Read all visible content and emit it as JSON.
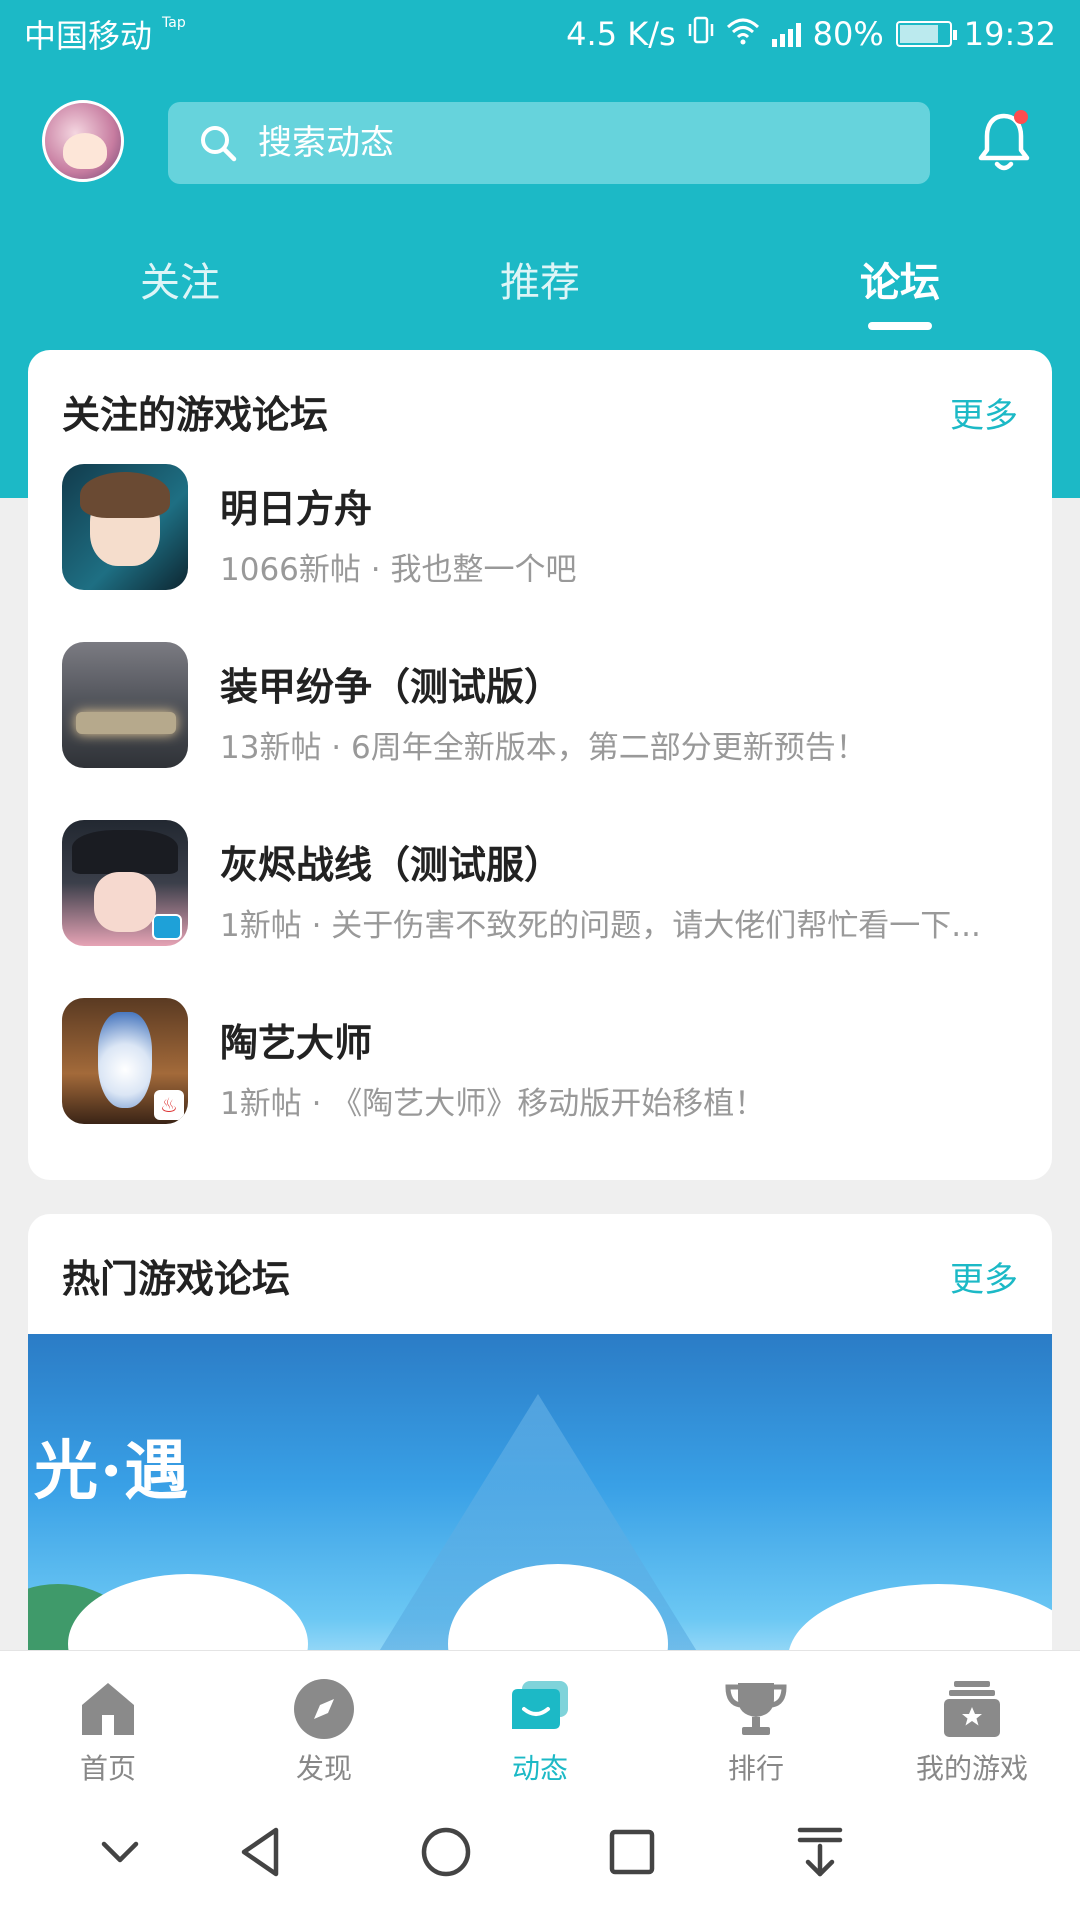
{
  "status_bar": {
    "carrier": "中国移动",
    "carrier_badge": "Tap",
    "speed": "4.5 K/s",
    "battery": "80%",
    "time": "19:32"
  },
  "header": {
    "search_placeholder": "搜索动态",
    "notification_dot_color": "#ff4d4f"
  },
  "tabs": [
    {
      "label": "关注",
      "active": false
    },
    {
      "label": "推荐",
      "active": false
    },
    {
      "label": "论坛",
      "active": true
    }
  ],
  "followed_forums": {
    "title": "关注的游戏论坛",
    "more": "更多",
    "items": [
      {
        "name": "明日方舟",
        "desc": "1066新帖 · 我也整一个吧"
      },
      {
        "name": "装甲纷争（测试版）",
        "desc": "13新帖 · 6周年全新版本，第二部分更新预告！"
      },
      {
        "name": "灰烬战线（测试服）",
        "desc": "1新帖 · 关于伤害不致死的问题，请大佬们帮忙看一下..."
      },
      {
        "name": "陶艺大师",
        "desc": "1新帖 · 《陶艺大师》移动版开始移植！"
      }
    ]
  },
  "hot_forums": {
    "title": "热门游戏论坛",
    "more": "更多",
    "banner_logo": "光·遇"
  },
  "bottom_nav": [
    {
      "label": "首页",
      "icon": "home-icon",
      "active": false
    },
    {
      "label": "发现",
      "icon": "compass-icon",
      "active": false
    },
    {
      "label": "动态",
      "icon": "chat-icon",
      "active": true
    },
    {
      "label": "排行",
      "icon": "trophy-icon",
      "active": false
    },
    {
      "label": "我的游戏",
      "icon": "game-library-icon",
      "active": false
    }
  ],
  "colors": {
    "accent": "#1cb9c6",
    "inactive": "#888888"
  }
}
